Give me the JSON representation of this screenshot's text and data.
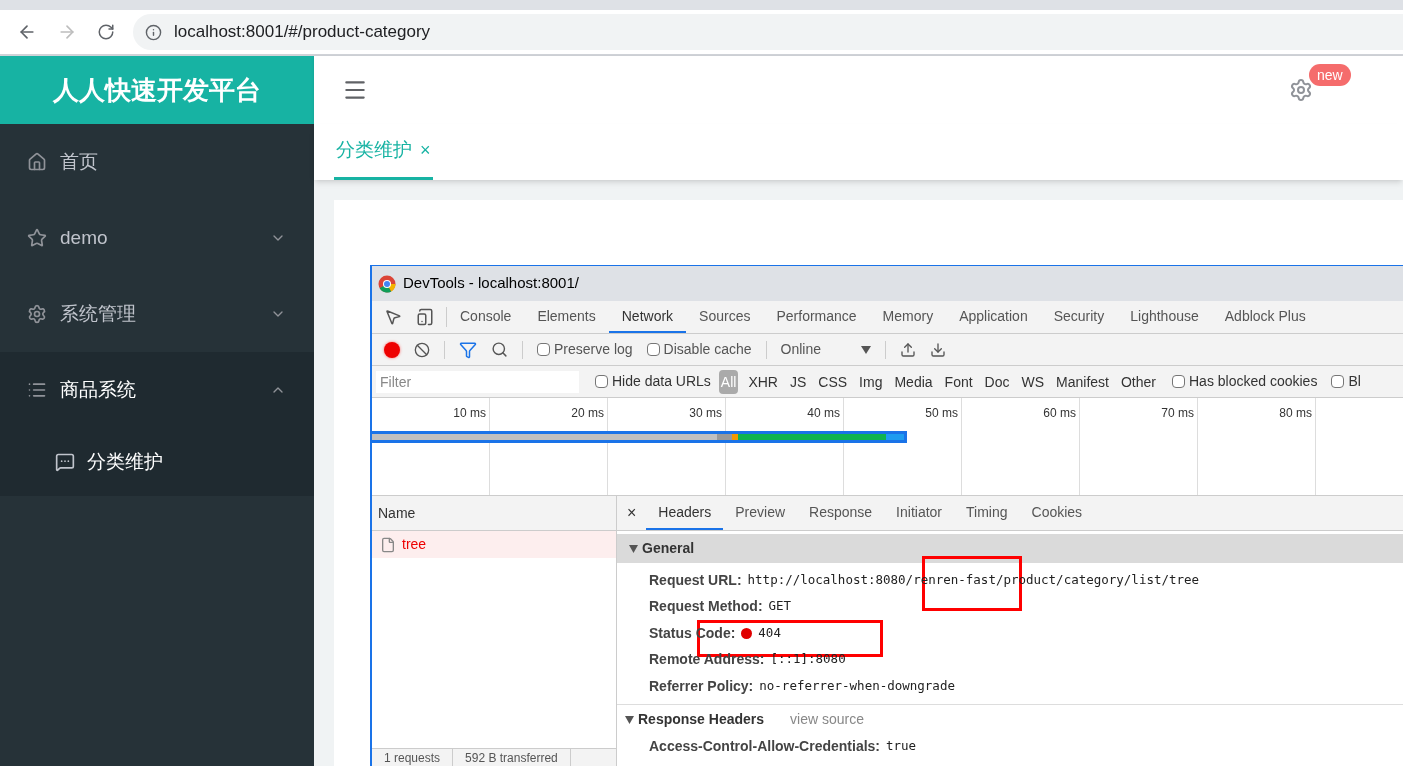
{
  "browser": {
    "url": "localhost:8001/#/product-category"
  },
  "sidebar": {
    "logo": "人人快速开发平台",
    "items": [
      {
        "label": "首页",
        "kind": "link"
      },
      {
        "label": "demo",
        "kind": "submenu",
        "expanded": false
      },
      {
        "label": "系统管理",
        "kind": "submenu",
        "expanded": false
      },
      {
        "label": "商品系统",
        "kind": "submenu",
        "expanded": true,
        "children": [
          {
            "label": "分类维护"
          }
        ]
      }
    ]
  },
  "header": {
    "badge": "new"
  },
  "tabs": [
    {
      "label": "分类维护",
      "selected": true,
      "close": "×"
    }
  ],
  "devtools": {
    "title": "DevTools - localhost:8001/",
    "panels": [
      {
        "label": "Console",
        "selected": false
      },
      {
        "label": "Elements",
        "selected": false
      },
      {
        "label": "Network",
        "selected": true
      },
      {
        "label": "Sources",
        "selected": false
      },
      {
        "label": "Performance",
        "selected": false
      },
      {
        "label": "Memory",
        "selected": false
      },
      {
        "label": "Application",
        "selected": false
      },
      {
        "label": "Security",
        "selected": false
      },
      {
        "label": "Lighthouse",
        "selected": false
      },
      {
        "label": "Adblock Plus",
        "selected": false
      }
    ],
    "recording": true,
    "preserve_log": {
      "label": "Preserve log",
      "checked": false
    },
    "disable_cache": {
      "label": "Disable cache",
      "checked": false
    },
    "throttle": "Online",
    "filter": {
      "placeholder": "Filter"
    },
    "hide_data_urls": {
      "label": "Hide data URLs",
      "checked": false
    },
    "types": [
      {
        "label": "All",
        "selected": true
      },
      {
        "label": "XHR",
        "selected": false
      },
      {
        "label": "JS",
        "selected": false
      },
      {
        "label": "CSS",
        "selected": false
      },
      {
        "label": "Img",
        "selected": false
      },
      {
        "label": "Media",
        "selected": false
      },
      {
        "label": "Font",
        "selected": false
      },
      {
        "label": "Doc",
        "selected": false
      },
      {
        "label": "WS",
        "selected": false
      },
      {
        "label": "Manifest",
        "selected": false
      },
      {
        "label": "Other",
        "selected": false
      }
    ],
    "extra_filters": [
      {
        "label": "Has blocked cookies",
        "checked": false
      },
      {
        "label": "Bl",
        "checked": false
      }
    ],
    "ticks": [
      "10 ms",
      "20 ms",
      "30 ms",
      "40 ms",
      "50 ms",
      "60 ms",
      "70 ms",
      "80 ms"
    ],
    "name_column": "Name",
    "requests": [
      {
        "name": "tree",
        "selected": true,
        "failed": true
      }
    ],
    "detail_close": "×",
    "detail_tabs": [
      {
        "label": "Headers",
        "selected": true
      },
      {
        "label": "Preview",
        "selected": false
      },
      {
        "label": "Response",
        "selected": false
      },
      {
        "label": "Initiator",
        "selected": false
      },
      {
        "label": "Timing",
        "selected": false
      },
      {
        "label": "Cookies",
        "selected": false
      }
    ],
    "general": {
      "title": "General",
      "expanded": true,
      "rows": [
        {
          "key": "Request URL:",
          "value": "http://localhost:8080/renren-fast/product/category/list/tree",
          "kind": "text"
        },
        {
          "key": "Request Method:",
          "value": "GET",
          "kind": "text"
        },
        {
          "key": "Status Code:",
          "value": "404",
          "kind": "status",
          "color": "#e00000"
        },
        {
          "key": "Remote Address:",
          "value": "[::1]:8080",
          "kind": "text"
        },
        {
          "key": "Referrer Policy:",
          "value": "no-referrer-when-downgrade",
          "kind": "text"
        }
      ]
    },
    "response_headers": {
      "title": "Response Headers",
      "expanded": true,
      "link": "view source",
      "rows": [
        {
          "key": "Access-Control-Allow-Credentials:",
          "value": "true"
        }
      ]
    },
    "status_bar": [
      "1 requests",
      "592 B transferred"
    ]
  }
}
